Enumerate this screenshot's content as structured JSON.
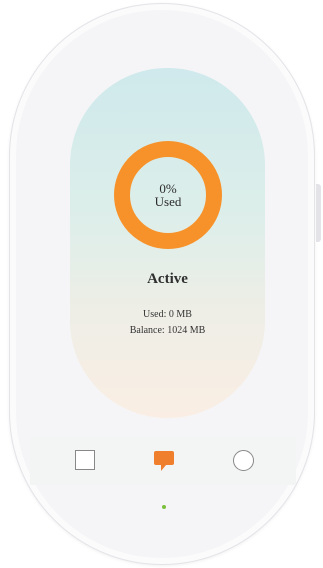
{
  "usage": {
    "percent_label": "0%",
    "used_caption": "Used",
    "used_fraction": 0
  },
  "status": {
    "label": "Active"
  },
  "stats": {
    "used": "Used: 0 MB",
    "balance": "Balance: 1024 MB"
  },
  "nav": {
    "items": [
      {
        "icon": "square-icon",
        "active": false
      },
      {
        "icon": "chat-bubble-icon",
        "active": true
      },
      {
        "icon": "circle-icon",
        "active": false
      }
    ]
  },
  "colors": {
    "accent": "#f7922a",
    "indicator": "#7bbf3c"
  }
}
